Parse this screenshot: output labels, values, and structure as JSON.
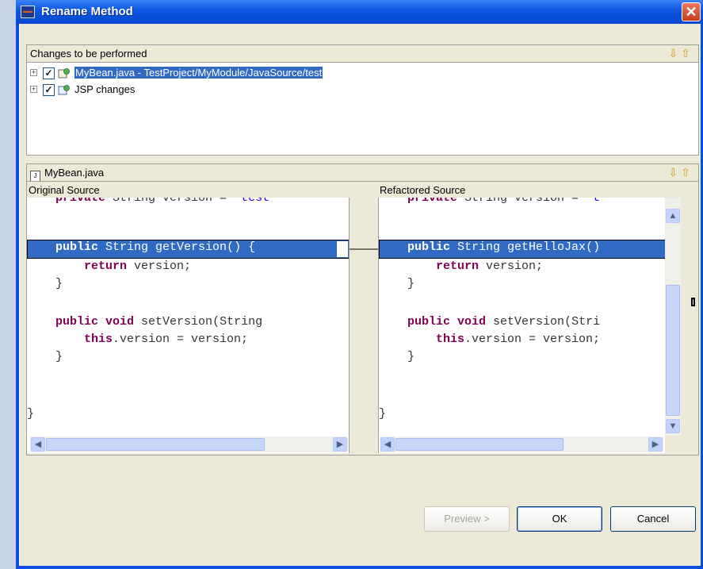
{
  "window": {
    "title": "Rename Method"
  },
  "changes_panel": {
    "label": "Changes to be performed",
    "tree": [
      {
        "text": "MyBean.java - TestProject/MyModule/JavaSource/test",
        "checked": true,
        "selected": true
      },
      {
        "text": "JSP changes",
        "checked": true,
        "selected": false
      }
    ]
  },
  "file_panel": {
    "label": "MyBean.java"
  },
  "original": {
    "title": "Original Source",
    "method_name": "getVersion"
  },
  "refactored": {
    "title": "Refactored Source",
    "method_name": "getHelloJax"
  },
  "buttons": {
    "preview": "Preview >",
    "ok": "OK",
    "cancel": "Cancel"
  }
}
